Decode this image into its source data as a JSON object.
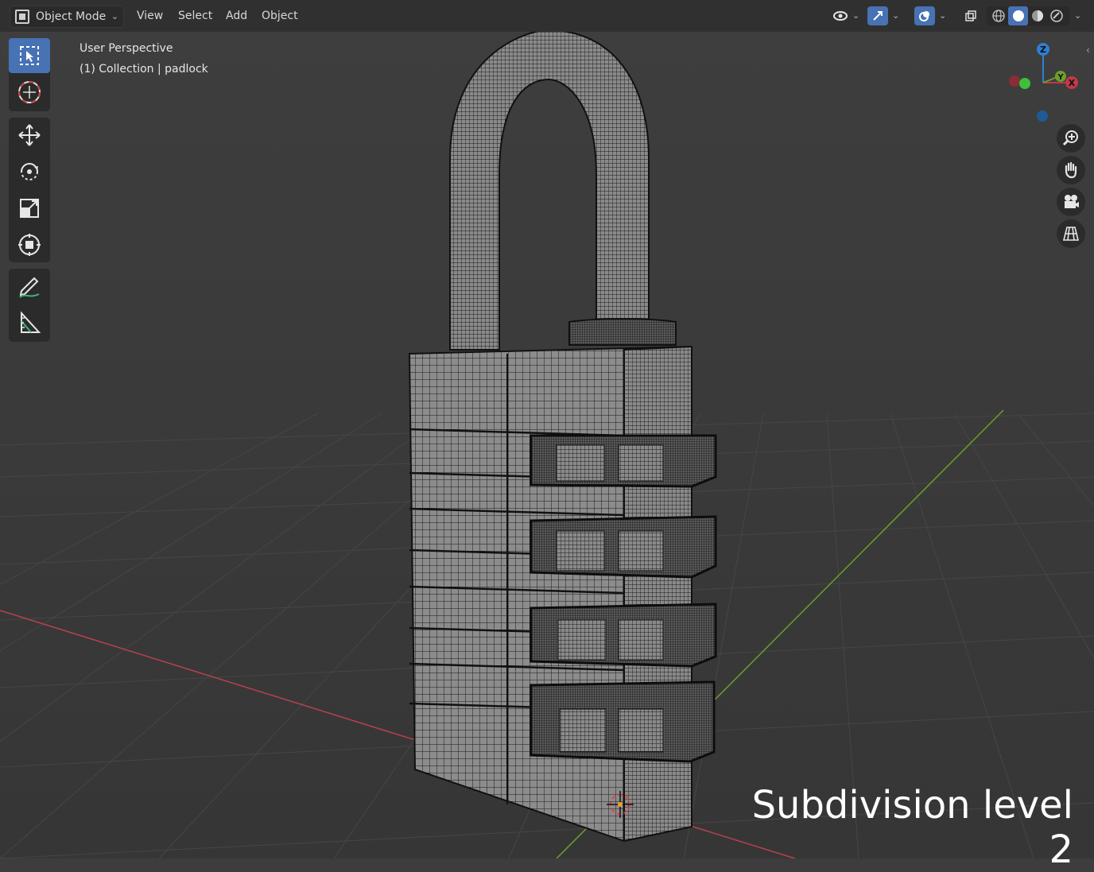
{
  "header": {
    "mode": "Object Mode",
    "menus": {
      "view": "View",
      "select": "Select",
      "add": "Add",
      "object": "Object"
    },
    "shading_icons": [
      "wireframe-shading-icon",
      "solid-shading-icon",
      "material-preview-icon",
      "rendered-shading-icon"
    ]
  },
  "viewport": {
    "perspective": "User Perspective",
    "collection": "(1) Collection | padlock"
  },
  "toolbar": {
    "tools": [
      "select-box-icon",
      "cursor-icon",
      "move-icon",
      "rotate-icon",
      "scale-icon",
      "transform-icon",
      "annotate-icon",
      "measure-icon"
    ],
    "active_tool": "select-box-icon"
  },
  "gizmo": {
    "z": "Z",
    "y": "Y",
    "x": "X"
  },
  "navigation": [
    "zoom-icon",
    "pan-hand-icon",
    "camera-icon",
    "ortho-grid-icon"
  ],
  "caption": "Subdivision level 2",
  "colors": {
    "header_bg": "#303030",
    "viewport_bg": "#3d3d3d",
    "accent": "#4772b3",
    "x_axis": "#c0394a",
    "y_axis": "#6f9e2a",
    "z_axis": "#2f7fd1"
  }
}
